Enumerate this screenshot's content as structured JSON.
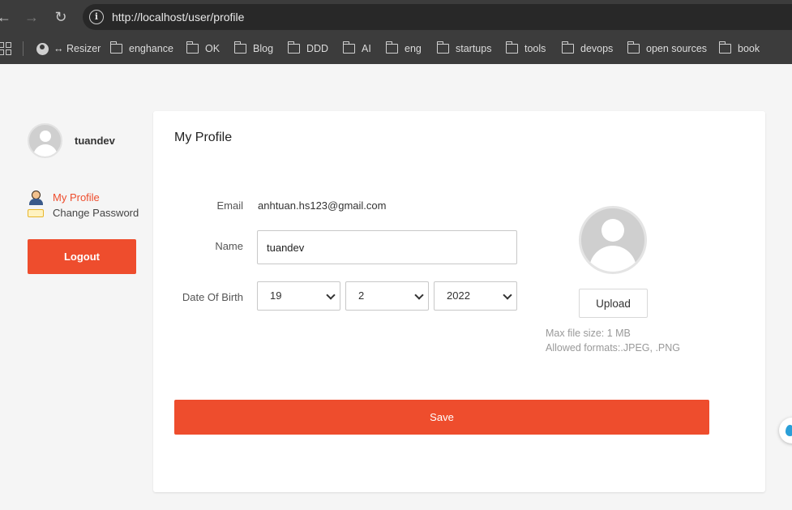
{
  "browser": {
    "url": "http://localhost/user/profile",
    "bookmarks": [
      {
        "label": "↔ Resizer",
        "icon": "globe-icon"
      },
      {
        "label": "enghance",
        "icon": "folder-icon"
      },
      {
        "label": "OK",
        "icon": "folder-icon"
      },
      {
        "label": "Blog",
        "icon": "folder-icon"
      },
      {
        "label": "DDD",
        "icon": "folder-icon"
      },
      {
        "label": "AI",
        "icon": "folder-icon"
      },
      {
        "label": "eng",
        "icon": "folder-icon"
      },
      {
        "label": "startups",
        "icon": "folder-icon"
      },
      {
        "label": "tools",
        "icon": "folder-icon"
      },
      {
        "label": "devops",
        "icon": "folder-icon"
      },
      {
        "label": "open sources",
        "icon": "folder-icon"
      },
      {
        "label": "book",
        "icon": "folder-icon"
      }
    ]
  },
  "sidebar": {
    "username": "tuandev",
    "items": [
      {
        "label": "My Profile",
        "icon": "user-icon",
        "active": true
      },
      {
        "label": "Change Password",
        "icon": "key-icon",
        "active": false
      }
    ],
    "logout_label": "Logout"
  },
  "profile": {
    "title": "My Profile",
    "email_label": "Email",
    "email_value": "anhtuan.hs123@gmail.com",
    "name_label": "Name",
    "name_value": "tuandev",
    "dob_label": "Date Of Birth",
    "dob_day": "19",
    "dob_month": "2",
    "dob_year": "2022",
    "upload_label": "Upload",
    "max_size_text": "Max file size: 1 MB",
    "formats_text": "Allowed formats:.JPEG, .PNG",
    "save_label": "Save"
  },
  "colors": {
    "accent": "#ee4d2d",
    "page_background": "#f5f5f5"
  }
}
